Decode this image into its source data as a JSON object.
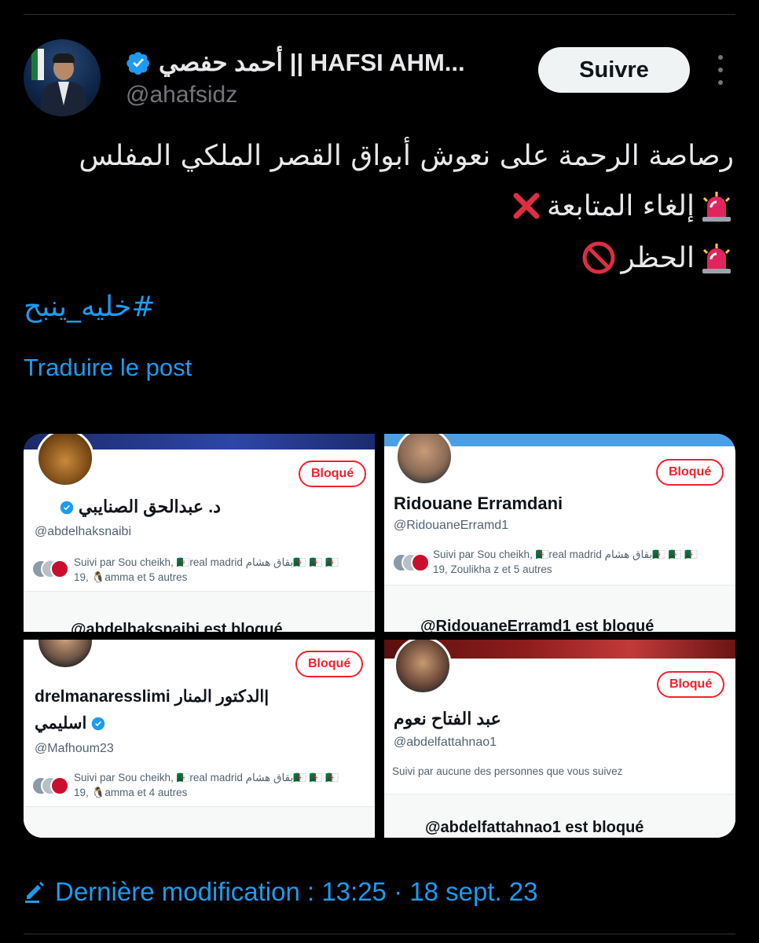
{
  "header": {
    "display_name": "أحمد حفصي || HAFSI AHM...",
    "handle": "@ahafsidz",
    "follow_label": "Suivre"
  },
  "tweet": {
    "line1": "رصاصة الرحمة على نعوش أبواق القصر الملكي المفلس",
    "line2": "إلغاء المتابعة",
    "line3": "الحظر",
    "hashtag": "#خليه_ينبح",
    "translate_label": "Traduire le post"
  },
  "cards": [
    {
      "blocked_badge": "Bloqué",
      "name": "د. عبدالحق الصنايبي",
      "handle": "@abdelhaksnaibi",
      "followed_by_1": "Suivi par Sou cheikh, 🇩🇿real madrid بقاق هشام🇩🇿 🇩🇿 🇩🇿",
      "followed_by_2": "19, 🐧amma et 5 autres",
      "blocked_text": "@abdelhaksnaibi est bloqué"
    },
    {
      "blocked_badge": "Bloqué",
      "name": "Ridouane Erramdani",
      "handle": "@RidouaneErramd1",
      "followed_by_1": "Suivi par Sou cheikh, 🇩🇿real madrid بقاق هشام🇩🇿 🇩🇿 🇩🇿",
      "followed_by_2": "19, Zoulikha z et 5 autres",
      "blocked_text": "@RidouaneErramd1 est bloqué"
    },
    {
      "blocked_badge": "Bloqué",
      "name_line1": "drelmanaresslimi الدكتور المنار|",
      "name_line2": "اسليمي",
      "handle": "@Mafhoum23",
      "followed_by_1": "Suivi par Sou cheikh, 🇩🇿real madrid بقاق هشام🇩🇿 🇩🇿 🇩🇿",
      "followed_by_2": "19, 🐧amma et 4 autres"
    },
    {
      "blocked_badge": "Bloqué",
      "name": "عبد الفتاح نعوم",
      "handle": "@abdelfattahnao1",
      "followed_by": "Suivi par aucune des personnes que vous suivez",
      "blocked_text": "@abdelfattahnao1 est bloqué"
    }
  ],
  "footer": {
    "edited_label": "Dernière modification : 13:25 · 18 sept. 23"
  },
  "colors": {
    "accent": "#1d9bf0",
    "blocked_red": "#f4212e",
    "background": "#000000"
  },
  "icons": [
    "verified-badge-icon",
    "more-options-icon",
    "siren-icon",
    "cross-mark-icon",
    "no-entry-icon",
    "pencil-icon"
  ]
}
